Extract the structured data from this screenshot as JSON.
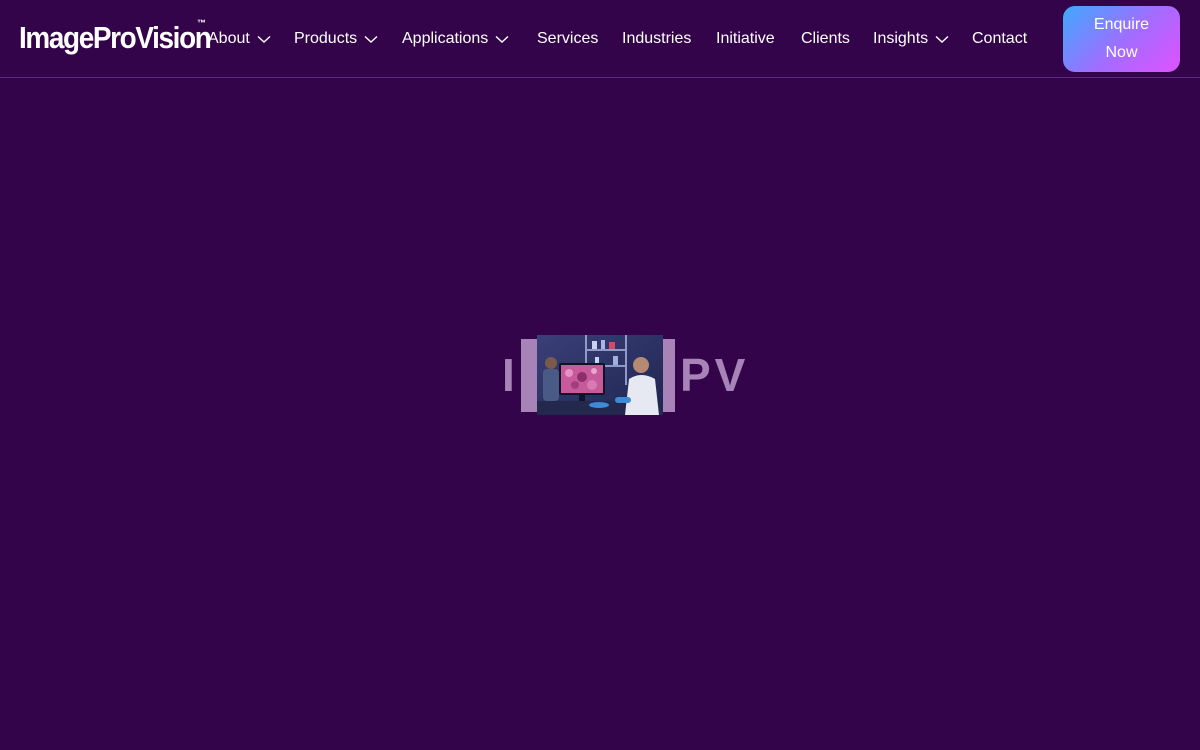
{
  "logo": {
    "text": "ImageProVision",
    "trademark": "™"
  },
  "nav": {
    "items": [
      {
        "label": "About",
        "has_dropdown": true
      },
      {
        "label": "Products",
        "has_dropdown": true
      },
      {
        "label": "Applications",
        "has_dropdown": true
      },
      {
        "label": "Services",
        "has_dropdown": false
      },
      {
        "label": "Industries",
        "has_dropdown": false
      },
      {
        "label": "Initiative",
        "has_dropdown": false
      },
      {
        "label": "Clients",
        "has_dropdown": false
      },
      {
        "label": "Insights",
        "has_dropdown": true
      },
      {
        "label": "Contact",
        "has_dropdown": false
      }
    ],
    "dropdown_icon": "chevron-down-icon"
  },
  "cta": {
    "line1": "Enquire",
    "line2": "Now"
  },
  "preloader": {
    "letter_left": "I",
    "letters_right": "PV",
    "image_subject": "lab-microscopy-photo"
  },
  "colors": {
    "background": "#330449",
    "header_border": "#5a2a86",
    "nav_text": "#ffffff",
    "cta_gradient_start": "#3fa9ff",
    "cta_gradient_end": "#e052ff",
    "preloader_accent": "#a883b8"
  }
}
